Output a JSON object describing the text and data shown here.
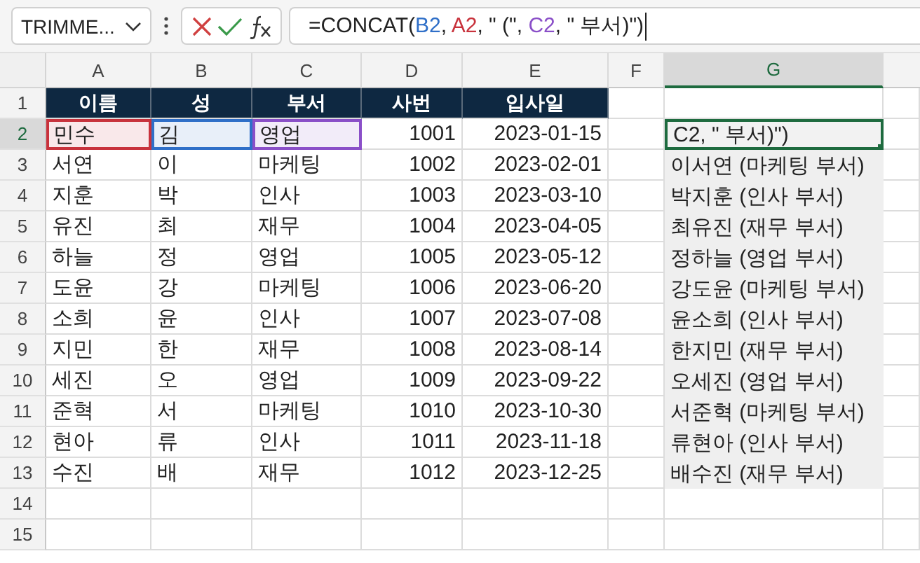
{
  "name_box": {
    "value": "TRIMME..."
  },
  "formula": [
    {
      "text": "=CONCAT("
    },
    {
      "text": "B2",
      "color": "#2f6fc8"
    },
    {
      "text": ", "
    },
    {
      "text": "A2",
      "color": "#c8323c"
    },
    {
      "text": ", \" (\", "
    },
    {
      "text": "C2",
      "color": "#8a4fc8"
    },
    {
      "text": ", \" 부서)\")"
    }
  ],
  "columns": [
    {
      "label": "A",
      "selected": false
    },
    {
      "label": "B",
      "selected": false
    },
    {
      "label": "C",
      "selected": false
    },
    {
      "label": "D",
      "selected": false
    },
    {
      "label": "E",
      "selected": false
    },
    {
      "label": "F",
      "selected": false
    },
    {
      "label": "G",
      "selected": true
    }
  ],
  "header": {
    "number": "1",
    "cells": [
      "이름",
      "성",
      "부서",
      "사번",
      "입사일"
    ]
  },
  "rows": [
    {
      "number": "2",
      "selected": true,
      "cells": [
        {
          "text": "민수",
          "color": "#c8323c"
        },
        {
          "text": "김",
          "color": "#2f6fc8"
        },
        {
          "text": "영업",
          "color": "#8a4fc8"
        },
        "1001",
        "2023-01-15"
      ],
      "result": {
        "text": "C2, \" 부서)\")",
        "selected": true
      }
    },
    {
      "number": "3",
      "selected": false,
      "cells": [
        "서연",
        "이",
        "마케팅",
        "1002",
        "2023-02-01"
      ],
      "result": {
        "text": "이서연 (마케팅 부서)",
        "selected": false
      }
    },
    {
      "number": "4",
      "selected": false,
      "cells": [
        "지훈",
        "박",
        "인사",
        "1003",
        "2023-03-10"
      ],
      "result": {
        "text": "박지훈 (인사 부서)",
        "selected": false
      }
    },
    {
      "number": "5",
      "selected": false,
      "cells": [
        "유진",
        "최",
        "재무",
        "1004",
        "2023-04-05"
      ],
      "result": {
        "text": "최유진 (재무 부서)",
        "selected": false
      }
    },
    {
      "number": "6",
      "selected": false,
      "cells": [
        "하늘",
        "정",
        "영업",
        "1005",
        "2023-05-12"
      ],
      "result": {
        "text": "정하늘 (영업 부서)",
        "selected": false
      }
    },
    {
      "number": "7",
      "selected": false,
      "cells": [
        "도윤",
        "강",
        "마케팅",
        "1006",
        "2023-06-20"
      ],
      "result": {
        "text": "강도윤 (마케팅 부서)",
        "selected": false
      }
    },
    {
      "number": "8",
      "selected": false,
      "cells": [
        "소희",
        "윤",
        "인사",
        "1007",
        "2023-07-08"
      ],
      "result": {
        "text": "윤소희 (인사 부서)",
        "selected": false
      }
    },
    {
      "number": "9",
      "selected": false,
      "cells": [
        "지민",
        "한",
        "재무",
        "1008",
        "2023-08-14"
      ],
      "result": {
        "text": "한지민 (재무 부서)",
        "selected": false
      }
    },
    {
      "number": "10",
      "selected": false,
      "cells": [
        "세진",
        "오",
        "영업",
        "1009",
        "2023-09-22"
      ],
      "result": {
        "text": "오세진 (영업 부서)",
        "selected": false
      }
    },
    {
      "number": "11",
      "selected": false,
      "cells": [
        "준혁",
        "서",
        "마케팅",
        "1010",
        "2023-10-30"
      ],
      "result": {
        "text": "서준혁 (마케팅 부서)",
        "selected": false
      }
    },
    {
      "number": "12",
      "selected": false,
      "cells": [
        "현아",
        "류",
        "인사",
        "1011",
        "2023-11-18"
      ],
      "result": {
        "text": "류현아 (인사 부서)",
        "selected": false
      }
    },
    {
      "number": "13",
      "selected": false,
      "cells": [
        "수진",
        "배",
        "재무",
        "1012",
        "2023-12-25"
      ],
      "result": {
        "text": "배수진 (재무 부서)",
        "selected": false
      }
    }
  ],
  "empty_rows": [
    "14",
    "15"
  ]
}
